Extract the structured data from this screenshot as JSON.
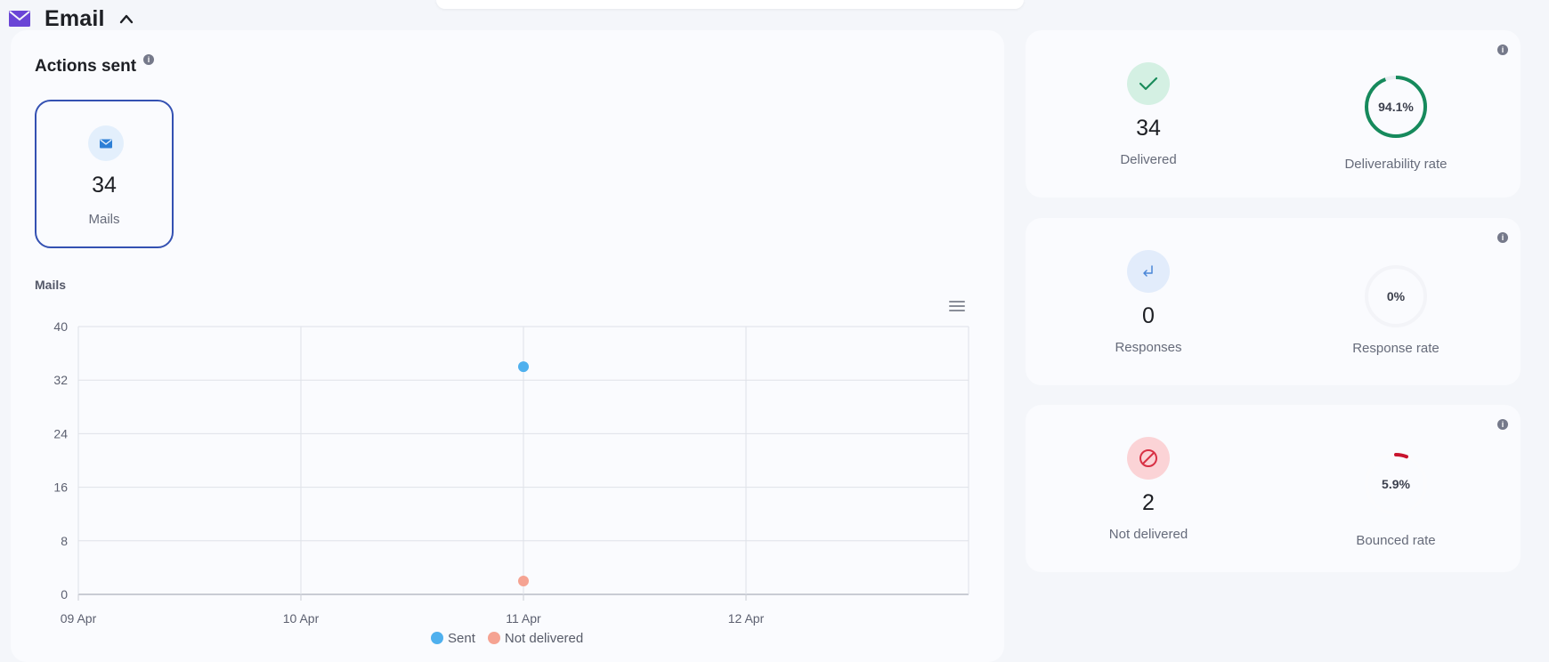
{
  "section": {
    "title": "Email"
  },
  "actions": {
    "title": "Actions sent",
    "info": "i",
    "tile": {
      "value": "34",
      "label": "Mails"
    }
  },
  "chart_title": "Mails",
  "chart_data": {
    "type": "scatter",
    "x": [
      "09 Apr",
      "10 Apr",
      "11 Apr",
      "12 Apr"
    ],
    "series": [
      {
        "name": "Sent",
        "color": "#4fb0ee",
        "points": [
          {
            "x": "11 Apr",
            "y": 34
          }
        ]
      },
      {
        "name": "Not delivered",
        "color": "#f5a392",
        "points": [
          {
            "x": "11 Apr",
            "y": 2
          }
        ]
      }
    ],
    "ylim": [
      0,
      40
    ],
    "yticks": [
      0,
      8,
      16,
      24,
      32,
      40
    ],
    "grid": true,
    "legend": "bottom-center"
  },
  "stats": {
    "delivered": {
      "value": "34",
      "label": "Delivered",
      "icon": "check-icon",
      "color": "#1a8c5b"
    },
    "deliverability": {
      "value": "94.1%",
      "fraction": 0.941,
      "label": "Deliverability rate",
      "color": "#168a5c"
    },
    "responses": {
      "value": "0",
      "label": "Responses",
      "icon": "reply-arrow-icon",
      "color": "#4a86d8"
    },
    "response_rate": {
      "value": "0%",
      "fraction": 0,
      "label": "Response rate"
    },
    "not_delivered": {
      "value": "2",
      "label": "Not delivered",
      "icon": "blocked-icon",
      "color": "#d83044"
    },
    "bounced": {
      "value": "5.9%",
      "fraction": 0.059,
      "label": "Bounced rate",
      "color": "#c8142e"
    }
  }
}
